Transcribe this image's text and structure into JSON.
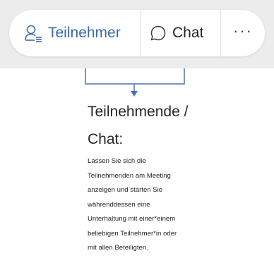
{
  "toolbar": {
    "participants": {
      "label": "Teilnehmer",
      "icon": "participants-icon"
    },
    "chat": {
      "label": "Chat",
      "icon": "chat-bubble-icon"
    },
    "more": {
      "label": "···",
      "icon": "more-icon"
    }
  },
  "callout": {
    "title_line1": "Teilnehmende /",
    "title_line2": "Chat:",
    "description_lines": [
      "Lassen Sie sich die",
      "Teilnehmenden am Meeting",
      "anzeigen und starten Sie",
      "währenddessen eine",
      "Unterhaltung mit einer*einem",
      "beliebigen Teilnehmer*in oder",
      "mit allen Beteiligten."
    ]
  },
  "colors": {
    "accent": "#3b6aa8",
    "toolbar_background": "#ececec",
    "text": "#262626"
  }
}
